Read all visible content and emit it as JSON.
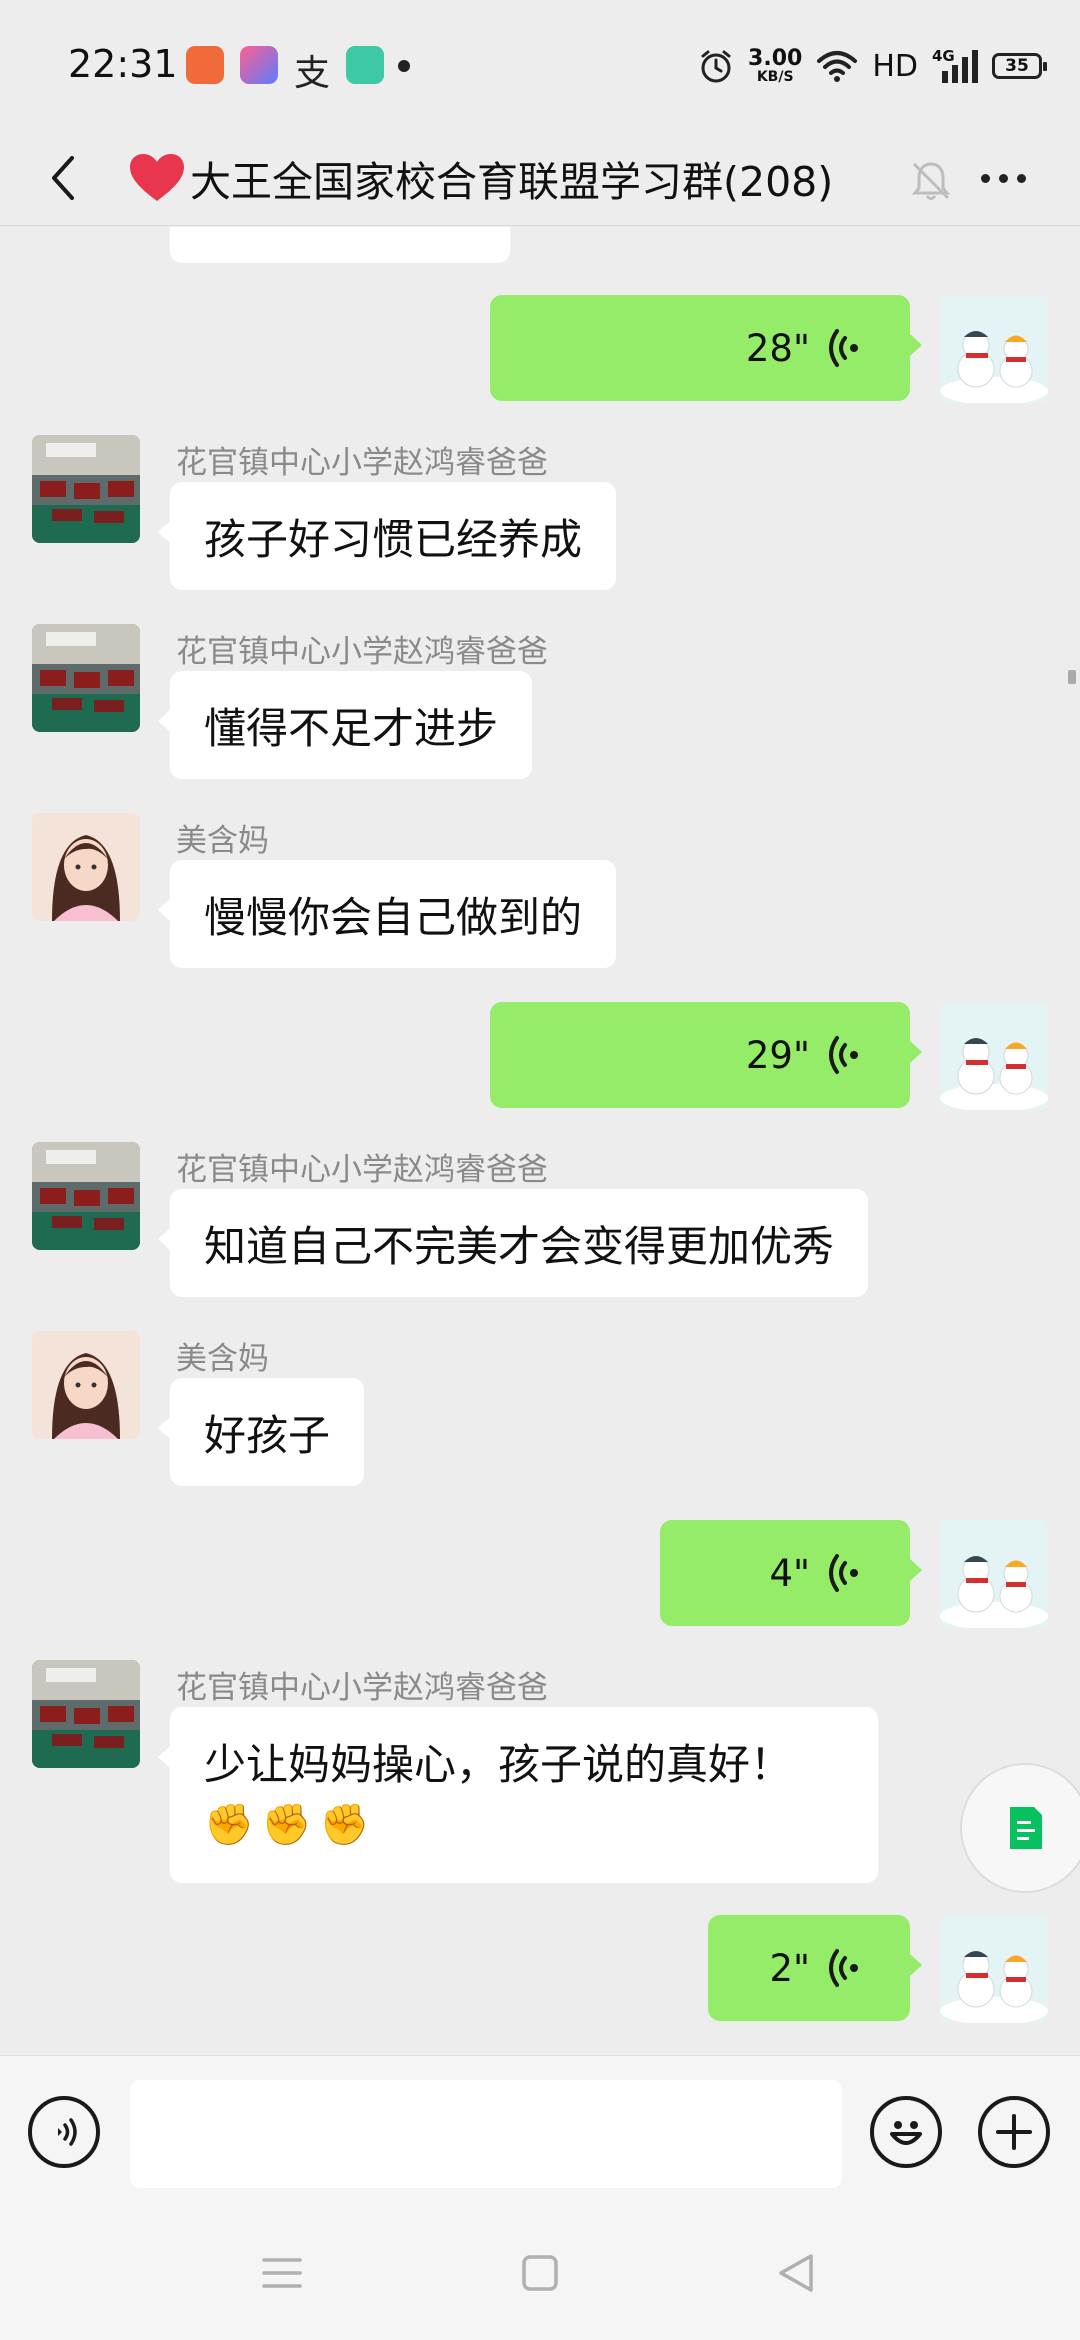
{
  "status_bar": {
    "time": "22:31",
    "net_speed_value": "3.00",
    "net_speed_unit": "KB/S",
    "hd_label": "HD",
    "network_label": "4G",
    "battery": "35"
  },
  "header": {
    "title": "大王全国家校合育联盟学习群(208)"
  },
  "messages": [
    {
      "type": "voice",
      "duration": "28\""
    },
    {
      "type": "text",
      "sender": "花官镇中心小学赵鸿睿爸爸",
      "text": "孩子好习惯已经养成"
    },
    {
      "type": "text",
      "sender": "花官镇中心小学赵鸿睿爸爸",
      "text": "懂得不足才进步"
    },
    {
      "type": "text",
      "sender": "美含妈",
      "text": "慢慢你会自己做到的"
    },
    {
      "type": "voice",
      "duration": "29\""
    },
    {
      "type": "text",
      "sender": "花官镇中心小学赵鸿睿爸爸",
      "text": "知道自己不完美才会变得更加优秀"
    },
    {
      "type": "text",
      "sender": "美含妈",
      "text": "好孩子"
    },
    {
      "type": "voice",
      "duration": "4\""
    },
    {
      "type": "text",
      "sender": "花官镇中心小学赵鸿睿爸爸",
      "text": "少让妈妈操心，孩子说的真好！",
      "emoji": [
        "✊",
        "✊",
        "✊"
      ]
    },
    {
      "type": "voice",
      "duration": "2\""
    }
  ],
  "input": {
    "value": "",
    "placeholder": ""
  },
  "icons": {
    "back": "chevron-left-icon",
    "heart": "heart-icon",
    "mute": "bell-mute-icon",
    "more": "more-icon",
    "voice_input": "voice-input-icon",
    "emoji": "smiley-icon",
    "plus": "plus-icon",
    "doc": "document-icon"
  },
  "colors": {
    "background": "#ededed",
    "outgoing_bubble": "#95ec69",
    "incoming_bubble": "#ffffff",
    "heart": "#e8364f",
    "doc_green": "#07c160",
    "sender_gray": "#8a8a8a"
  }
}
